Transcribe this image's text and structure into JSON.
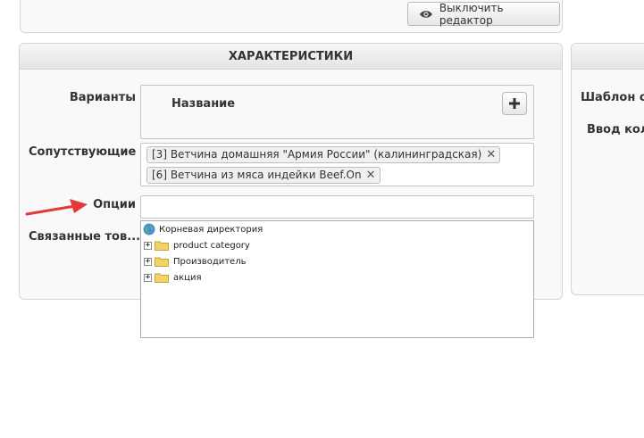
{
  "top": {
    "editor_button_label": "Выключить редактор"
  },
  "panel": {
    "title": "ХАРАКТЕРИСТИКИ"
  },
  "right_panel": {
    "row1": "Шаблон стр",
    "row2": "Ввод коли"
  },
  "fields": {
    "variants_label": "Варианты",
    "variants_column": "Название",
    "related_label": "Сопутствующие ...",
    "related_tags": [
      "[3] Ветчина домашняя \"Армия России\" (калининградская)",
      "[6] Ветчина из мяса индейки Beef.On"
    ],
    "options_label": "Опции",
    "options_value": "",
    "linked_label": "Связанные тов..."
  },
  "tree": {
    "root": "Корневая директория",
    "items": [
      "product category",
      "Производитель",
      "акция"
    ]
  },
  "colors": {
    "arrow": "#e53935"
  }
}
